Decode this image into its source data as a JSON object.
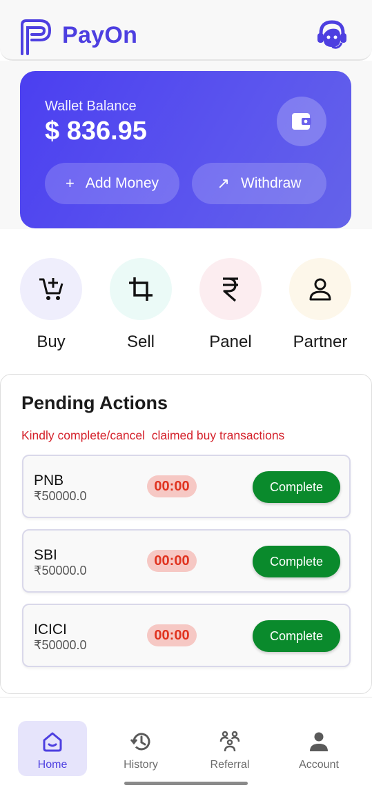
{
  "app": {
    "name": "PayOn"
  },
  "colors": {
    "brand": "#4d3fe0",
    "complete": "#0a8a2c",
    "warning": "#d4202a",
    "timer_bg": "#f6c8c4",
    "timer_text": "#e0331f"
  },
  "header": {
    "logo_icon": "payon-logo-icon",
    "support_icon": "support-agent-icon"
  },
  "wallet": {
    "label": "Wallet Balance",
    "amount": "$ 836.95",
    "icon": "wallet-icon",
    "add_money": {
      "icon": "+",
      "label": "Add Money"
    },
    "withdraw": {
      "icon": "↗",
      "label": "Withdraw"
    }
  },
  "quick_actions": [
    {
      "label": "Buy",
      "icon": "cart-plus-icon"
    },
    {
      "label": "Sell",
      "icon": "crop-icon"
    },
    {
      "label": "Panel",
      "icon": "rupee-icon"
    },
    {
      "label": "Partner",
      "icon": "person-icon"
    }
  ],
  "pending": {
    "title": "Pending Actions",
    "note": "Kindly complete/cancel  claimed buy transactions",
    "items": [
      {
        "bank": "PNB",
        "amount": "₹50000.0",
        "timer": "00:00",
        "action": "Complete"
      },
      {
        "bank": "SBI",
        "amount": "₹50000.0",
        "timer": "00:00",
        "action": "Complete"
      },
      {
        "bank": "ICICI",
        "amount": "₹50000.0",
        "timer": "00:00",
        "action": "Complete"
      }
    ]
  },
  "nav": [
    {
      "label": "Home",
      "icon": "home-icon",
      "active": true
    },
    {
      "label": "History",
      "icon": "history-icon"
    },
    {
      "label": "Referral",
      "icon": "referral-icon"
    },
    {
      "label": "Account",
      "icon": "account-icon"
    }
  ]
}
